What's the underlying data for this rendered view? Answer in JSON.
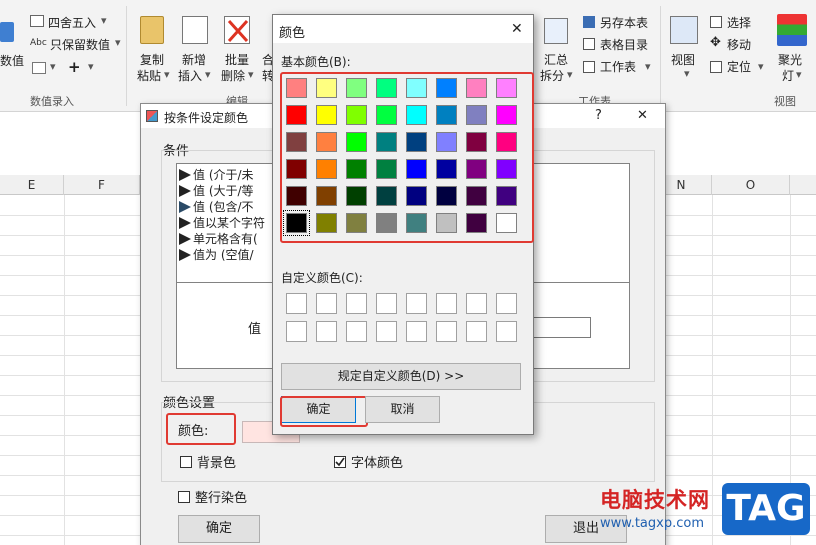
{
  "ribbon": {
    "round": "四舍五入",
    "keep_value": "只保留数值",
    "value_label": "数值",
    "number_input_group": "数值录入",
    "copy_paste": [
      "复制",
      "粘贴"
    ],
    "add_insert": [
      "新增",
      "插入"
    ],
    "batch_delete": [
      "批量",
      "删除"
    ],
    "edit_group": "编辑",
    "convert_frag": [
      "合",
      "转"
    ],
    "summarize": [
      "汇总",
      "拆分"
    ],
    "save_sheet": "另存本表",
    "sheet_dir": "表格目录",
    "worksheet": "工作表",
    "worksheet_group": "工作表",
    "view": "视图",
    "select": "选择",
    "move": "移动",
    "locate": "定位",
    "spotlight": [
      "聚光",
      "灯"
    ],
    "view_group": "视图"
  },
  "sheet": {
    "columns": [
      "E",
      "F",
      "N",
      "O"
    ]
  },
  "cond_dialog": {
    "title": "按条件设定颜色",
    "help": "?",
    "close": "✕",
    "conditions_label": "条件",
    "conditions": [
      "值 (介于/未",
      "值 (大于/等",
      "值 (包含/不",
      "值以某个字符",
      "单元格含有(",
      "值为 (空值/"
    ],
    "value_label": "值",
    "color_settings_label": "颜色设置",
    "color_label": "颜色:",
    "background_label": "背景色",
    "font_color_label": "字体颜色",
    "background_checked": false,
    "font_color_checked": true,
    "whole_row_label": "整行染色",
    "whole_row_checked": false,
    "ok_label": "确定",
    "exit_label": "退出"
  },
  "color_dialog": {
    "title": "颜色",
    "close": "✕",
    "basic_label": "基本颜色(B):",
    "custom_label": "自定义颜色(C):",
    "define_label": "规定自定义颜色(D) >>",
    "ok_label": "确定",
    "cancel_label": "取消",
    "basic_colors": [
      [
        "#ff8080",
        "#ffff80",
        "#80ff80",
        "#00ff80",
        "#80ffff",
        "#0080ff",
        "#ff80c0",
        "#ff80ff"
      ],
      [
        "#ff0000",
        "#ffff00",
        "#80ff00",
        "#00ff40",
        "#00ffff",
        "#0080c0",
        "#8080c0",
        "#ff00ff"
      ],
      [
        "#804040",
        "#ff8040",
        "#00ff00",
        "#008080",
        "#004080",
        "#8080ff",
        "#800040",
        "#ff0080"
      ],
      [
        "#800000",
        "#ff8000",
        "#008000",
        "#008040",
        "#0000ff",
        "#0000a0",
        "#800080",
        "#8000ff"
      ],
      [
        "#400000",
        "#804000",
        "#004000",
        "#004040",
        "#000080",
        "#000040",
        "#400040",
        "#400080"
      ],
      [
        "#000000",
        "#808000",
        "#808040",
        "#808080",
        "#408080",
        "#c0c0c0",
        "#400040",
        "#ffffff"
      ]
    ],
    "selected": "#000000"
  },
  "watermark": {
    "text": "电脑技术网",
    "url": "www.tagxp.com",
    "tag": "TAG"
  }
}
